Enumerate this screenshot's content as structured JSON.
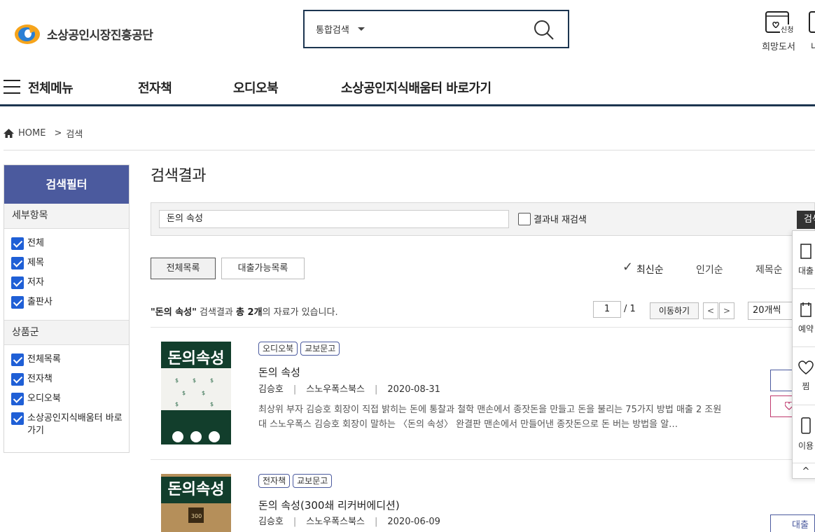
{
  "header": {
    "org_name": "소상공인시장진흥공단",
    "search_scope": "통합검색",
    "util": [
      {
        "label": "희망도서",
        "icon": "request-icon",
        "icon_text": "신청"
      },
      {
        "label": "내"
      }
    ]
  },
  "gnb": {
    "all_menu": "전체메뉴",
    "items": [
      "전자책",
      "오디오북",
      "소상공인지식배움터 바로가기"
    ]
  },
  "breadcrumb": {
    "home": "HOME",
    "sep": ">",
    "current": "검색"
  },
  "sidebar": {
    "title": "검색필터",
    "groups": [
      {
        "title": "세부항목",
        "items": [
          "전체",
          "제목",
          "저자",
          "출판사"
        ]
      },
      {
        "title": "상품군",
        "items": [
          "전체목록",
          "전자책",
          "오디오북",
          "소상공인지식배움터 바로가기"
        ]
      }
    ]
  },
  "main": {
    "title": "검색결과",
    "research": {
      "query": "돈의 속성",
      "within_label": "결과내 재검색",
      "button": "검색"
    },
    "tabs": [
      "전체목록",
      "대출가능목록"
    ],
    "sort": {
      "checked": "✓",
      "options": [
        "최신순",
        "인기순",
        "제목순"
      ]
    },
    "count": {
      "query": "\"돈의 속성\"",
      "mid": " 검색결과 ",
      "total": "총 2개",
      "tail": "의 자료가 있습니다."
    },
    "paging": {
      "current": "1",
      "total": "/ 1",
      "move": "이동하기",
      "prev": "<",
      "next": ">",
      "per_page": "20개씩"
    },
    "results": [
      {
        "cover_title": "돈의속성",
        "badges": [
          "오디오북",
          "교보문고"
        ],
        "title": "돈의 속성",
        "author": "김승호",
        "publisher": "스노우폭스북스",
        "date": "2020-08-31",
        "desc": "최상위 부자 김승호 회장이 직접 밝히는 돈에 통찰과 철학 맨손에서 종잣돈을 만들고 돈을 불리는 75가지 방법 매출 2 조원 대 스노우폭스 김승호 회장이 말하는 〈돈의 속성〉 완결판 맨손에서 만들어낸 종잣돈으로 돈 버는 방법을 알…"
      },
      {
        "cover_title": "돈의속성",
        "badges": [
          "전자책",
          "교보문고"
        ],
        "title": "돈의 속성(300쇄 리커버에디션)",
        "author": "김승호",
        "publisher": "스노우폭스북스",
        "date": "2020-06-09",
        "side_button": "대출"
      }
    ]
  },
  "side_panel": {
    "items": [
      {
        "label": "대출",
        "icon": "book-icon"
      },
      {
        "label": "예약",
        "icon": "bookmark-icon"
      },
      {
        "label": "찜",
        "icon": "heart-icon"
      },
      {
        "label": "이용",
        "icon": "device-icon"
      }
    ],
    "top": "^"
  },
  "colors": {
    "navy": "#1c3550",
    "filter": "#4b5a9e",
    "checkbox": "#1f5fd6"
  }
}
